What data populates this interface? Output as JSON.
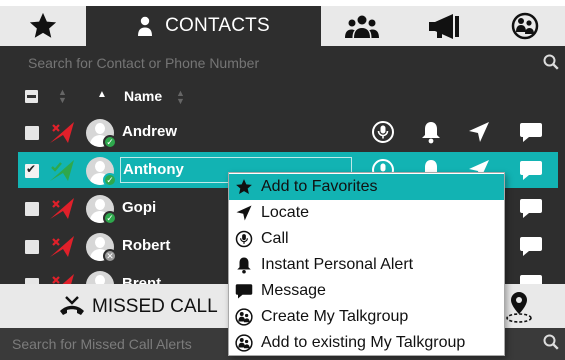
{
  "tabs": {
    "favorites_icon": "star-icon",
    "contacts_label": "CONTACTS",
    "groups_icon": "group-icon",
    "alerts_icon": "megaphone-icon",
    "talkgroup_icon": "talkgroup-icon"
  },
  "contacts": {
    "search_placeholder": "Search for Contact or Phone Number",
    "column_name": "Name",
    "rows": [
      {
        "name": "Andrew",
        "status": "red",
        "presence": "online",
        "checked": false
      },
      {
        "name": "Anthony",
        "status": "green",
        "presence": "online",
        "checked": true,
        "selected": true
      },
      {
        "name": "Gopi",
        "status": "red",
        "presence": "online",
        "checked": false
      },
      {
        "name": "Robert",
        "status": "red",
        "presence": "offline",
        "checked": false
      },
      {
        "name": "Brent",
        "status": "red",
        "presence": "online",
        "checked": false
      }
    ]
  },
  "missed_calls": {
    "title": "MISSED CALL",
    "search_placeholder": "Search for Missed Call Alerts"
  },
  "context_menu": {
    "items": [
      {
        "label": "Add to Favorites",
        "icon": "star-icon"
      },
      {
        "label": "Locate",
        "icon": "locate-arrow-icon"
      },
      {
        "label": "Call",
        "icon": "call-icon"
      },
      {
        "label": "Instant Personal Alert",
        "icon": "bell-icon"
      },
      {
        "label": "Message",
        "icon": "message-icon"
      },
      {
        "label": "Create My Talkgroup",
        "icon": "talkgroup-icon"
      },
      {
        "label": "Add to existing My Talkgroup",
        "icon": "talkgroup-icon"
      }
    ]
  },
  "colors": {
    "panel_bg": "#2e2e2e",
    "accent": "#12b3b3",
    "tab_bg": "#e9e9e9",
    "status_red": "#e0202a",
    "status_green": "#2ea84c"
  }
}
